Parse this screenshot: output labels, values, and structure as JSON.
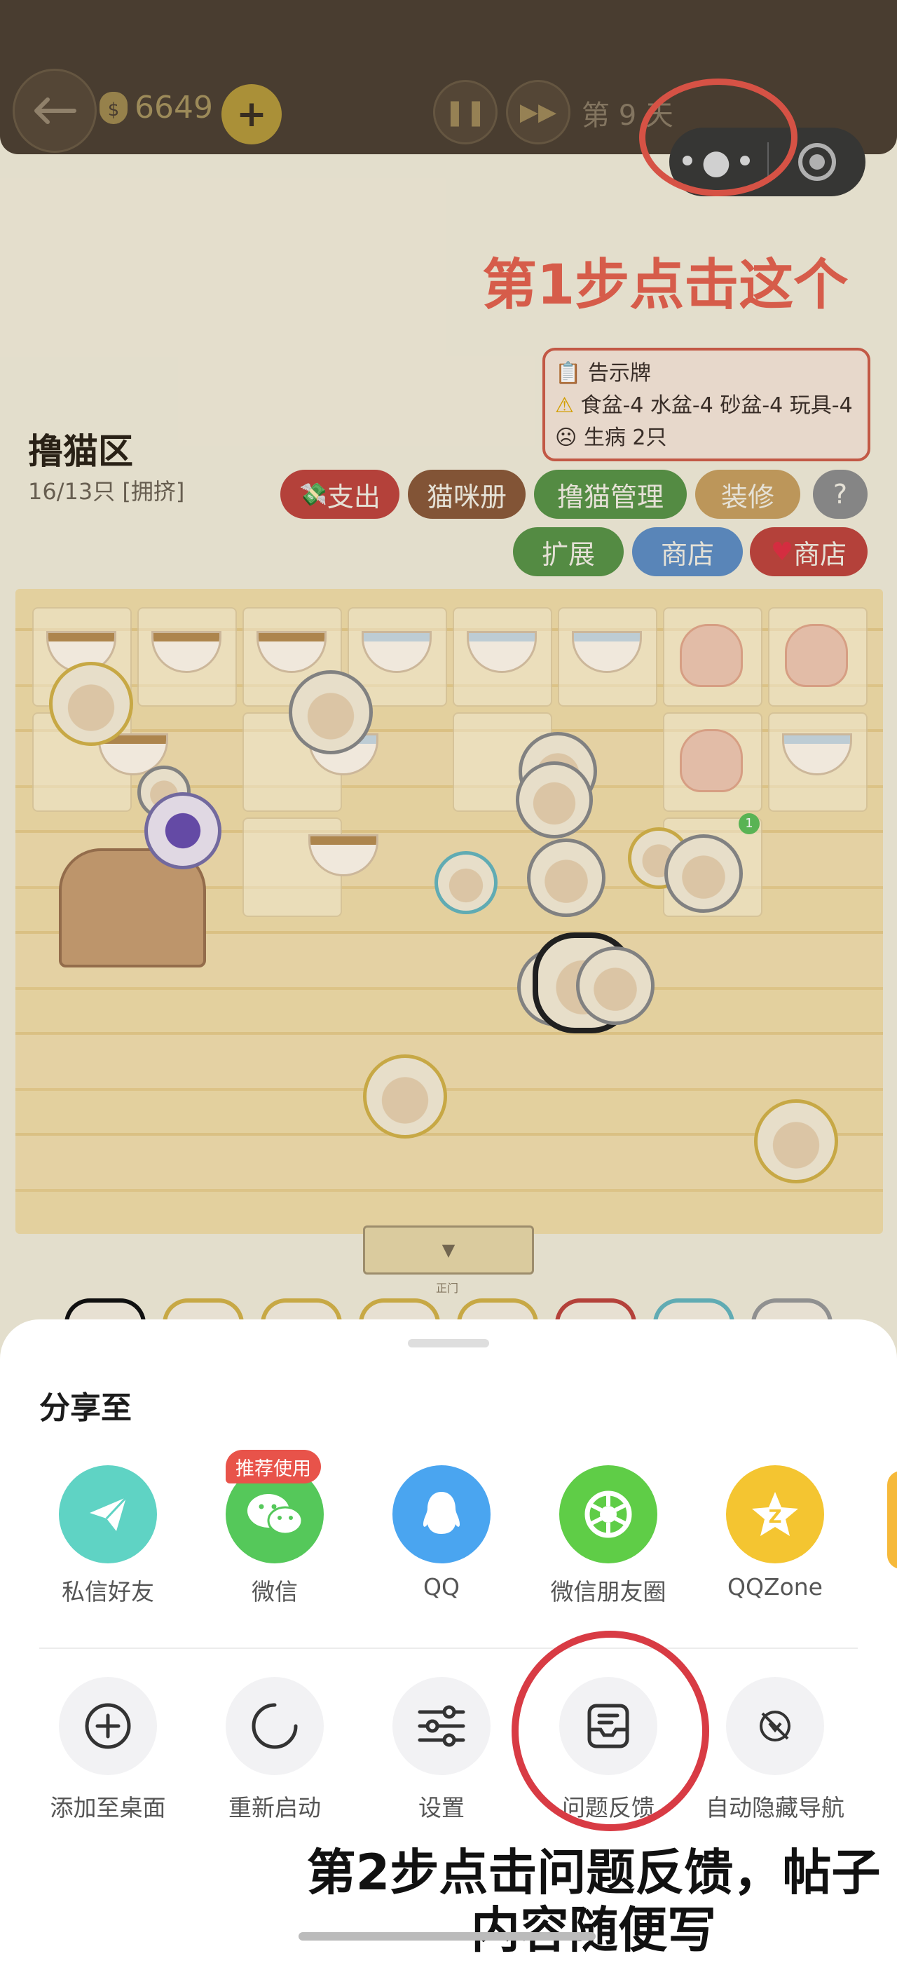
{
  "topbar": {
    "coins": "6649",
    "day": "第 9 天"
  },
  "annotations": {
    "step1": "第1步点击这个",
    "step2_line1": "第2步点击问题反馈，帖子",
    "step2_line2": "内容随便写"
  },
  "notice": {
    "title": "告示牌",
    "line1": "食盆-4 水盆-4 砂盆-4 玩具-4",
    "line2": "生病 2只"
  },
  "zone": {
    "title": "撸猫区",
    "count": "16/13只 [拥挤]"
  },
  "buttons": {
    "expense": "支出",
    "cat_book": "猫咪册",
    "cat_manage": "撸猫管理",
    "decorate": "装修",
    "help": "?",
    "expand": "扩展",
    "shop": "商店",
    "heart_shop": "商店"
  },
  "field": {
    "gate_label": "正门",
    "badge": "1"
  },
  "share": {
    "title": "分享至",
    "recommend_badge": "推荐使用",
    "items": [
      {
        "label": "私信好友",
        "icon": "paper-plane-icon",
        "color": "#5fd3c4"
      },
      {
        "label": "微信",
        "icon": "wechat-icon",
        "color": "#55c85a"
      },
      {
        "label": "QQ",
        "icon": "qq-penguin-icon",
        "color": "#4aa5f0"
      },
      {
        "label": "微信朋友圈",
        "icon": "moments-shutter-icon",
        "color": "#5fcd47"
      },
      {
        "label": "QQZone",
        "icon": "qzone-star-icon",
        "color": "#f4c531"
      }
    ]
  },
  "tools": {
    "items": [
      {
        "label": "添加至桌面",
        "icon": "add-circle-icon"
      },
      {
        "label": "重新启动",
        "icon": "restart-icon"
      },
      {
        "label": "设置",
        "icon": "settings-sliders-icon"
      },
      {
        "label": "问题反馈",
        "icon": "feedback-inbox-icon"
      },
      {
        "label": "自动隐藏导航",
        "icon": "hide-nav-icon"
      }
    ]
  }
}
